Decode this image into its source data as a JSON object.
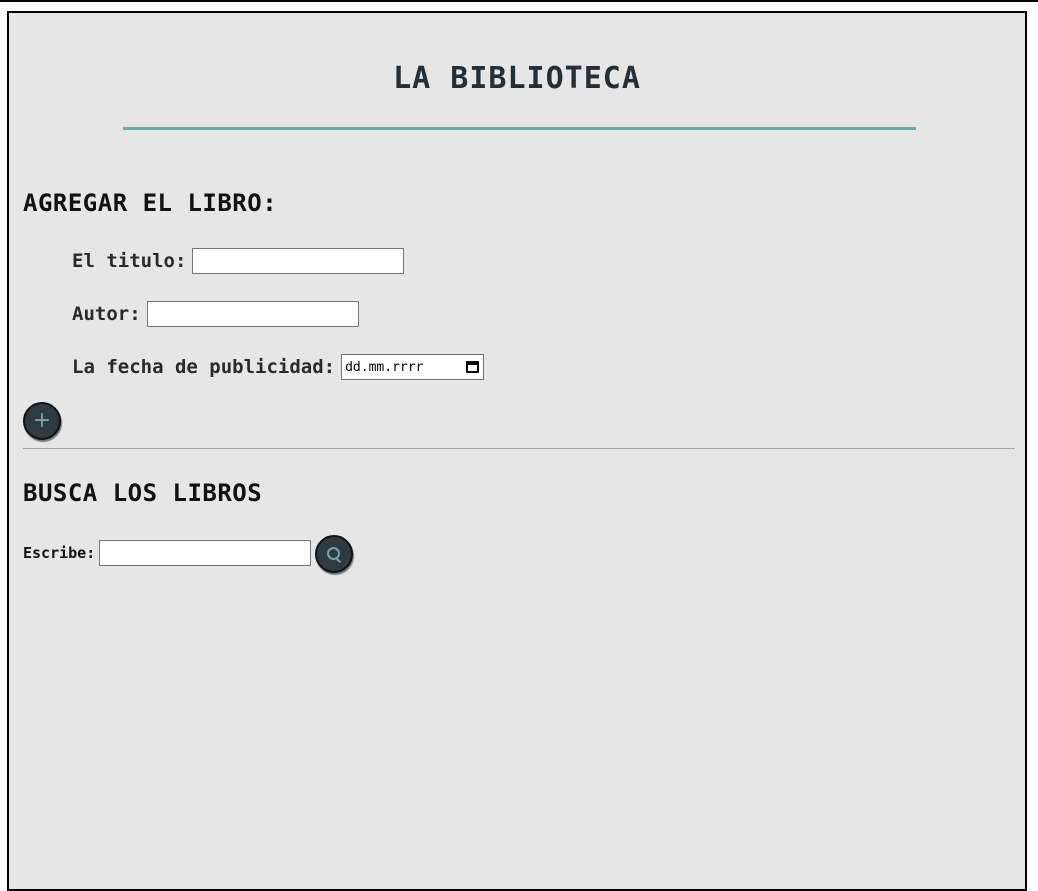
{
  "header": {
    "title": "LA BIBLIOTECA"
  },
  "add_book": {
    "heading": "AGREGAR EL LIBRO:",
    "title_label": "El titulo:",
    "title_value": "",
    "author_label": "Autor:",
    "author_value": "",
    "date_label": "La fecha de publicidad:",
    "date_placeholder": "dd.mm.rrrr",
    "add_button_icon": "plus-icon",
    "add_button_glyph": "+"
  },
  "search": {
    "heading": "BUSCA LOS LIBROS",
    "label": "Escribe:",
    "value": "",
    "button_icon": "magnifier-icon"
  },
  "colors": {
    "accent": "#73a6a8",
    "button_bg": "#2f3b42",
    "panel_bg": "#e6e6e6",
    "title_text": "#233038"
  }
}
